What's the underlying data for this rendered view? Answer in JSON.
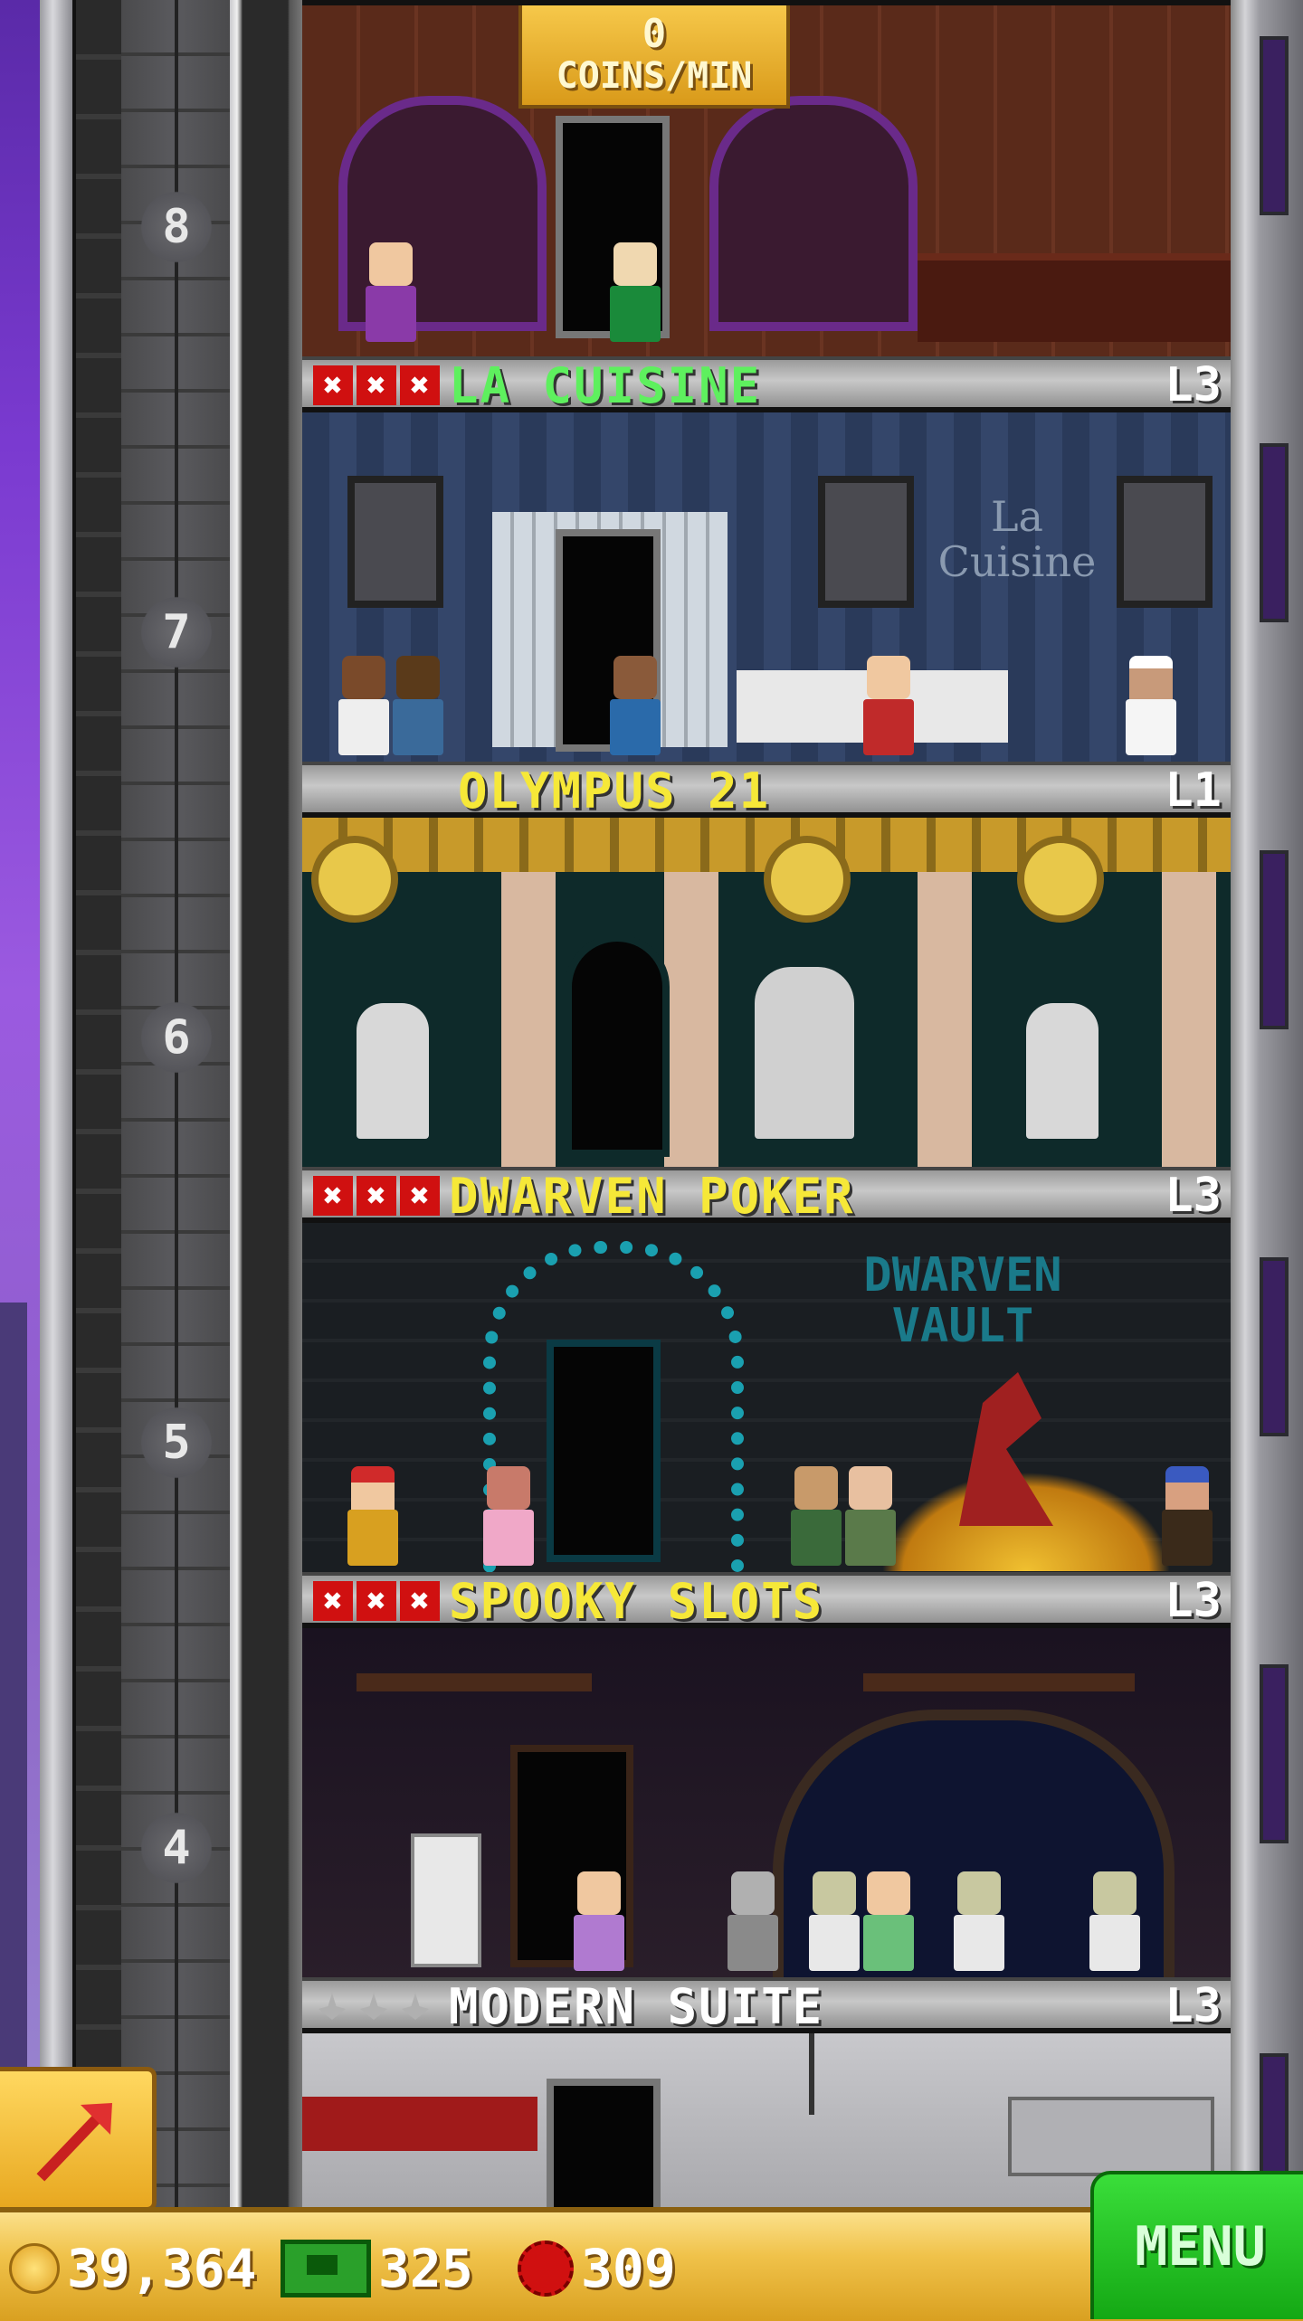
{
  "hud": {
    "coins_per_min_value": "0",
    "coins_per_min_unit": "COINS/MIN",
    "coins": "39,364",
    "bux": "325",
    "gems": "309",
    "menu_label": "MENU"
  },
  "floors": [
    {
      "number": "8"
    },
    {
      "number": "7",
      "name": "LA CUISINE",
      "level": "L3",
      "stars": "xxx",
      "name_color": "#5ef05e"
    },
    {
      "number": "6",
      "name": "OLYMPUS 21",
      "level": "L1",
      "stars": "",
      "name_color": "#f6e838"
    },
    {
      "number": "5",
      "name": "DWARVEN POKER",
      "level": "L3",
      "stars": "xxx",
      "name_color": "#f6e838"
    },
    {
      "number": "4",
      "name": "SPOOKY SLOTS",
      "level": "L3",
      "stars": "xxx",
      "name_color": "#f6e838"
    },
    {
      "name": "MODERN SUITE",
      "level": "L3",
      "stars": "empty",
      "name_color": "#ffffff"
    }
  ],
  "signs": {
    "dwarven_vault": "DWARVEN VAULT",
    "la_cuisine": "La Cuisine"
  },
  "icons": {
    "build": "red-arrow-icon",
    "coin": "coin-icon",
    "bux": "bux-icon",
    "gem": "gem-icon"
  },
  "colors": {
    "gold": "#f0c24a",
    "menu_green": "#22c022",
    "star_red": "#d01010"
  }
}
